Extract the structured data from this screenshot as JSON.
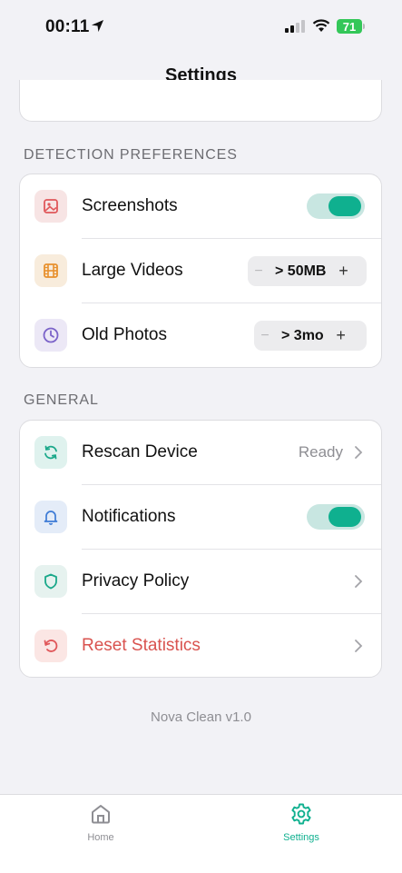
{
  "status_bar": {
    "time": "00:11",
    "battery": "71"
  },
  "nav": {
    "title": "Settings"
  },
  "sections": {
    "detection": {
      "header": "DETECTION PREFERENCES",
      "screenshots": {
        "label": "Screenshots",
        "icon": "image-icon",
        "enabled": true
      },
      "large_videos": {
        "label": "Large Videos",
        "icon": "film-icon",
        "value": "> 50MB",
        "minus": "−",
        "plus": "+"
      },
      "old_photos": {
        "label": "Old Photos",
        "icon": "clock-icon",
        "value": "> 3mo",
        "minus": "−",
        "plus": "+"
      }
    },
    "general": {
      "header": "GENERAL",
      "rescan": {
        "label": "Rescan Device",
        "icon": "refresh-icon",
        "value": "Ready"
      },
      "notifications": {
        "label": "Notifications",
        "icon": "bell-icon",
        "enabled": true
      },
      "privacy": {
        "label": "Privacy Policy",
        "icon": "shield-icon"
      },
      "reset": {
        "label": "Reset Statistics",
        "icon": "reset-icon"
      }
    }
  },
  "footer": {
    "version": "Nova Clean v1.0"
  },
  "tabbar": {
    "home": {
      "label": "Home",
      "icon": "home-icon"
    },
    "settings": {
      "label": "Settings",
      "icon": "gear-icon",
      "active": true
    }
  },
  "colors": {
    "accent": "#0fb08f",
    "danger": "#d9534f",
    "background": "#f2f2f6"
  }
}
